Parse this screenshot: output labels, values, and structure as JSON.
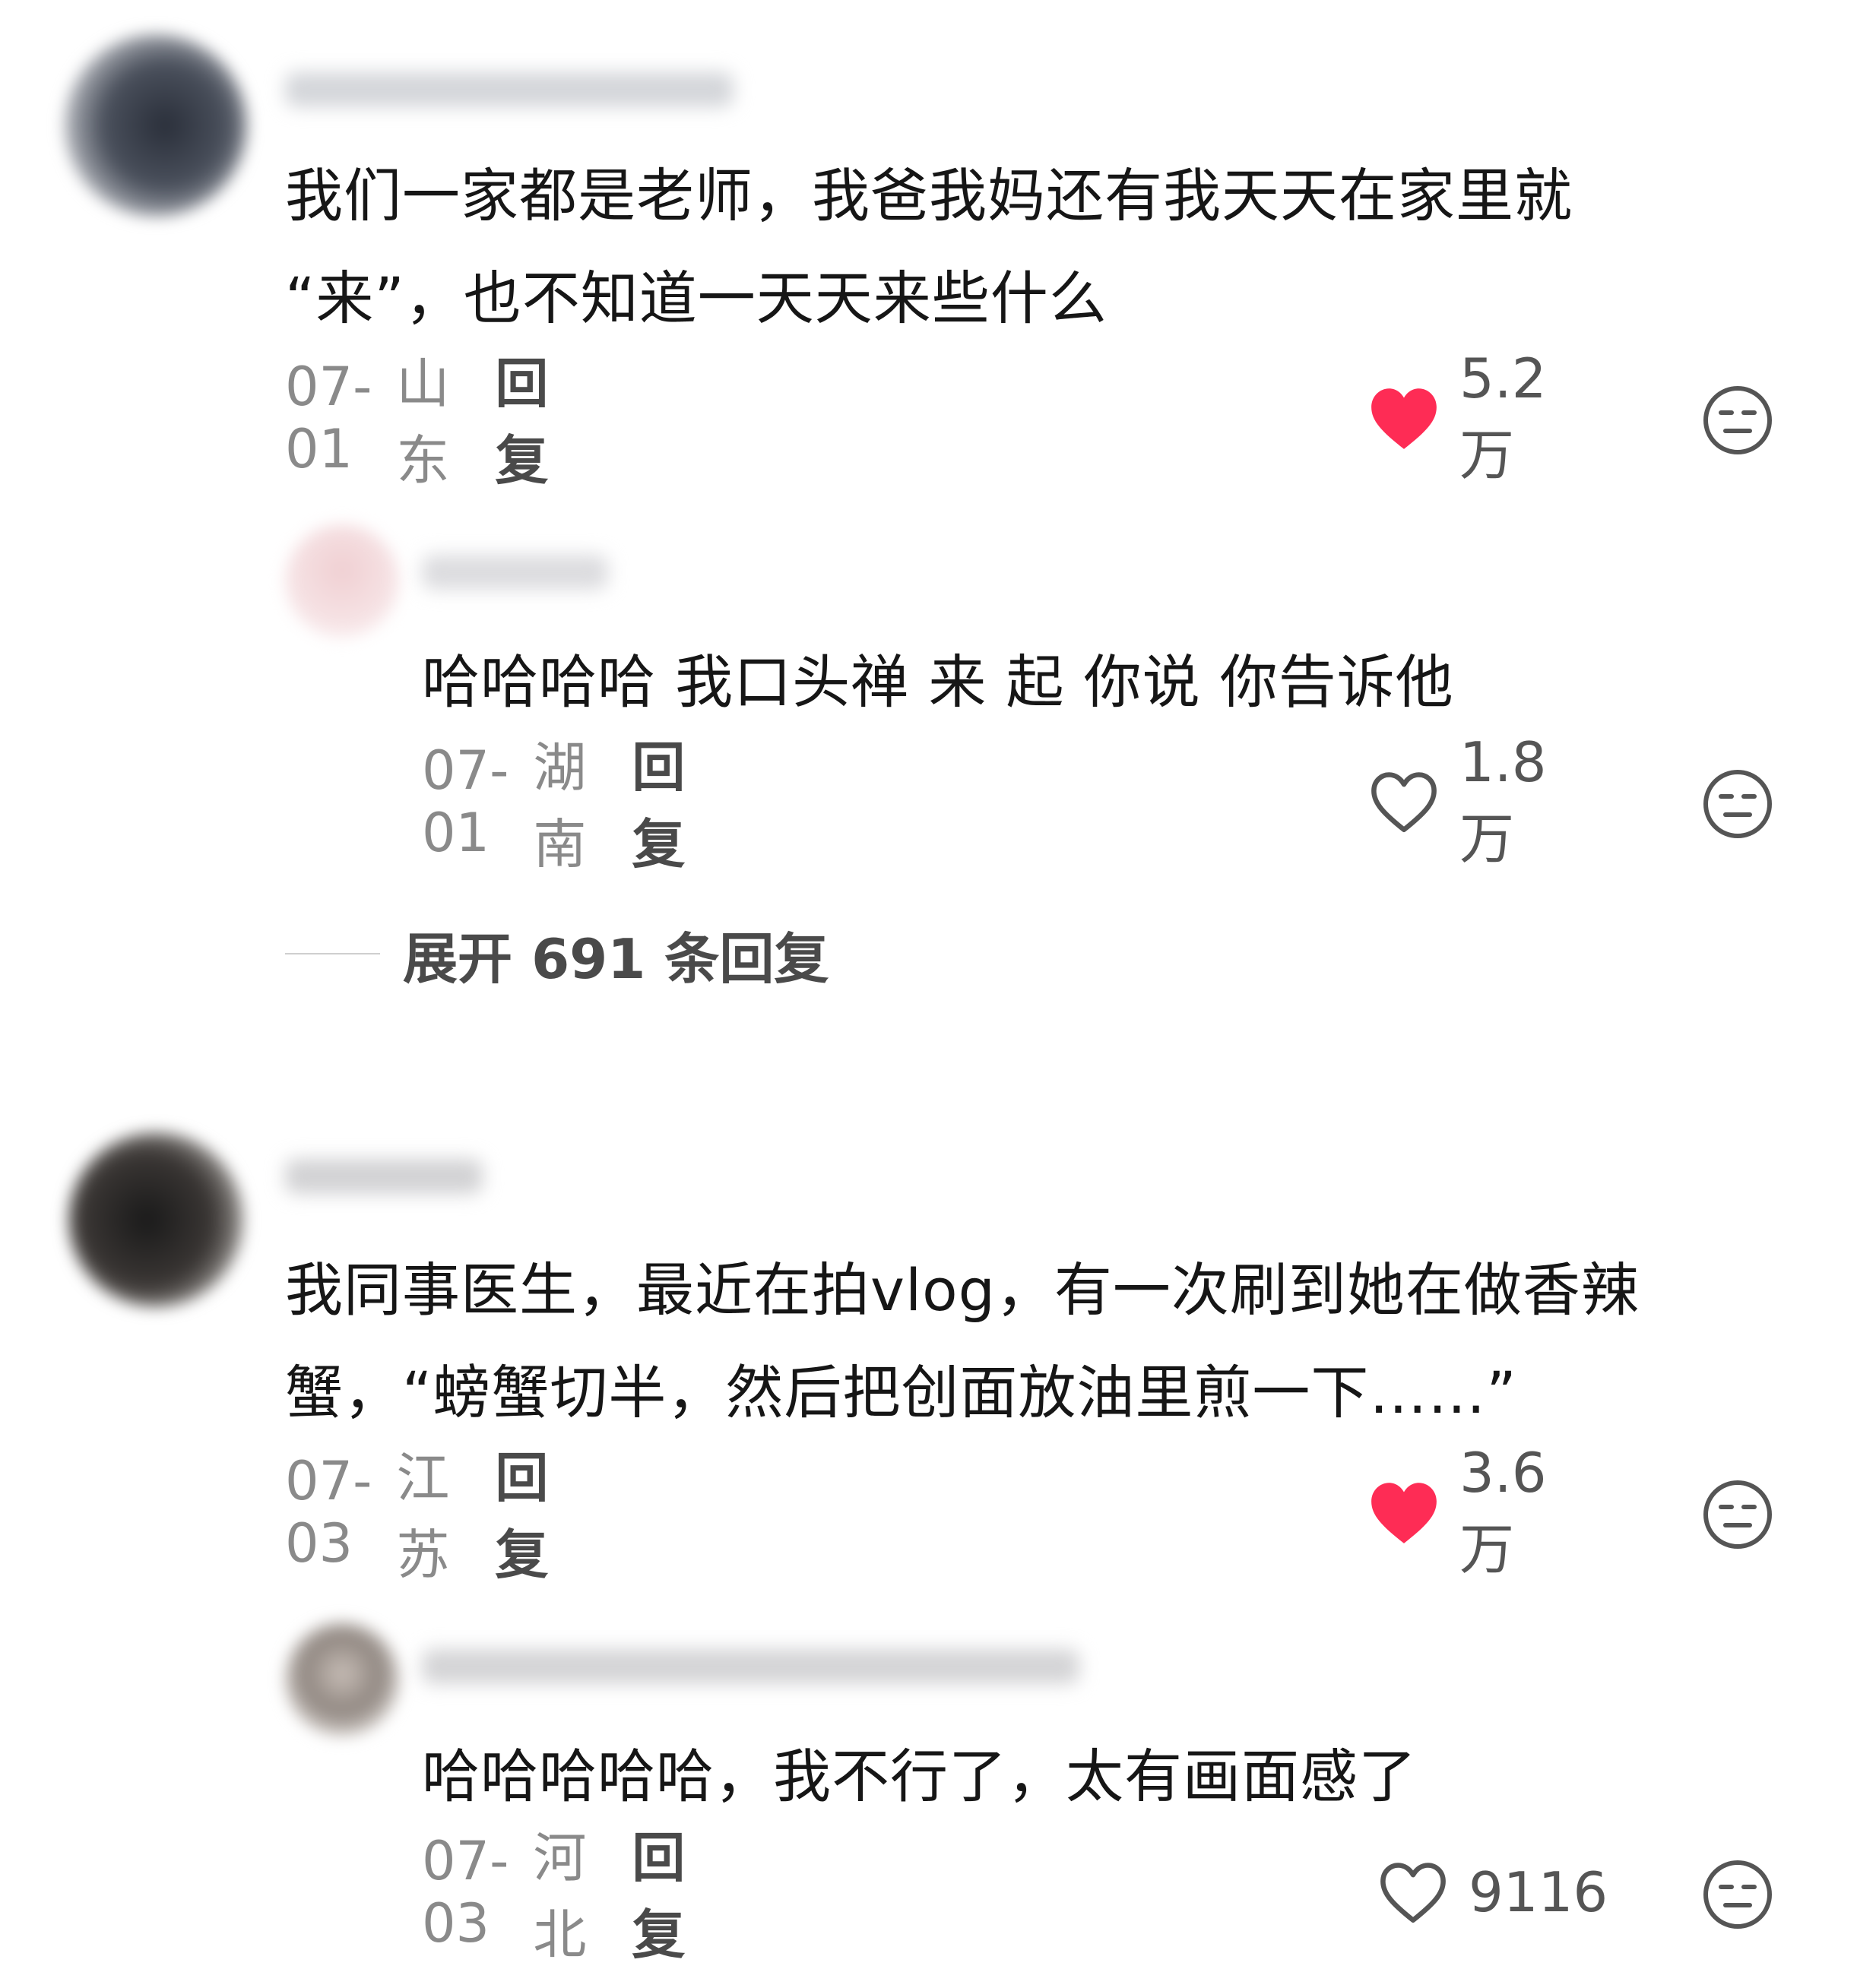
{
  "colors": {
    "like_active": "#fe2c55",
    "like_inactive": "#555555",
    "meta_gray": "#8a8a8a",
    "text": "#161616"
  },
  "comments": [
    {
      "text_lines": [
        "我们一家都是老师，我爸我妈还有我天天在家里就",
        "“来”，也不知道一天天来些什么"
      ],
      "date": "07-01",
      "region": "山东",
      "reply_label": "回复",
      "likes": "5.2万",
      "liked": true,
      "icons": {
        "like": "heart-filled-icon",
        "emoji": "face-neutral-icon"
      }
    },
    {
      "text_lines": [
        "哈哈哈哈 我口头禅 来 起 你说 你告诉他"
      ],
      "date": "07-01",
      "region": "湖南",
      "reply_label": "回复",
      "likes": "1.8万",
      "liked": false,
      "icons": {
        "like": "heart-outline-icon",
        "emoji": "face-neutral-icon"
      }
    },
    {
      "text_lines": [
        "我同事医生，最近在拍vlog，有一次刷到她在做香辣",
        "蟹，“螃蟹切半，然后把创面放油里煎一下……”"
      ],
      "date": "07-03",
      "region": "江苏",
      "reply_label": "回复",
      "likes": "3.6万",
      "liked": true,
      "icons": {
        "like": "heart-filled-icon",
        "emoji": "face-neutral-icon"
      }
    },
    {
      "text_lines": [
        "哈哈哈哈哈，我不行了，太有画面感了"
      ],
      "date": "07-03",
      "region": "河北",
      "reply_label": "回复",
      "likes": "9116",
      "liked": false,
      "icons": {
        "like": "heart-outline-icon",
        "emoji": "face-neutral-icon"
      }
    }
  ],
  "expand_replies": {
    "label": "展开 691 条回复"
  }
}
